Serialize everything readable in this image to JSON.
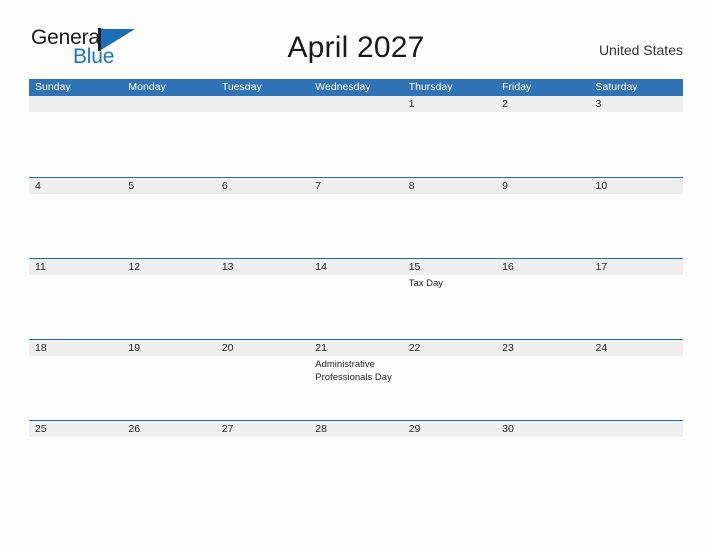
{
  "brand": {
    "name_part1": "General",
    "name_part2": "Blue",
    "flag_icon": "flag-icon",
    "accent_color": "#1b6db5"
  },
  "header": {
    "title": "April 2027",
    "locale": "United States"
  },
  "calendar": {
    "header_bg_color": "#2f72b5",
    "band_bg_color": "#efefef",
    "row_border_color": "#1f6cb0",
    "weekdays": [
      "Sunday",
      "Monday",
      "Tuesday",
      "Wednesday",
      "Thursday",
      "Friday",
      "Saturday"
    ],
    "weeks": [
      {
        "days": [
          {
            "number": "",
            "events": []
          },
          {
            "number": "",
            "events": []
          },
          {
            "number": "",
            "events": []
          },
          {
            "number": "",
            "events": []
          },
          {
            "number": "1",
            "events": []
          },
          {
            "number": "2",
            "events": []
          },
          {
            "number": "3",
            "events": []
          }
        ]
      },
      {
        "days": [
          {
            "number": "4",
            "events": []
          },
          {
            "number": "5",
            "events": []
          },
          {
            "number": "6",
            "events": []
          },
          {
            "number": "7",
            "events": []
          },
          {
            "number": "8",
            "events": []
          },
          {
            "number": "9",
            "events": []
          },
          {
            "number": "10",
            "events": []
          }
        ]
      },
      {
        "days": [
          {
            "number": "11",
            "events": []
          },
          {
            "number": "12",
            "events": []
          },
          {
            "number": "13",
            "events": []
          },
          {
            "number": "14",
            "events": []
          },
          {
            "number": "15",
            "events": [
              "Tax Day"
            ]
          },
          {
            "number": "16",
            "events": []
          },
          {
            "number": "17",
            "events": []
          }
        ]
      },
      {
        "days": [
          {
            "number": "18",
            "events": []
          },
          {
            "number": "19",
            "events": []
          },
          {
            "number": "20",
            "events": []
          },
          {
            "number": "21",
            "events": [
              "Administrative Professionals Day"
            ]
          },
          {
            "number": "22",
            "events": []
          },
          {
            "number": "23",
            "events": []
          },
          {
            "number": "24",
            "events": []
          }
        ]
      },
      {
        "days": [
          {
            "number": "25",
            "events": []
          },
          {
            "number": "26",
            "events": []
          },
          {
            "number": "27",
            "events": []
          },
          {
            "number": "28",
            "events": []
          },
          {
            "number": "29",
            "events": []
          },
          {
            "number": "30",
            "events": []
          },
          {
            "number": "",
            "events": []
          }
        ]
      }
    ]
  }
}
